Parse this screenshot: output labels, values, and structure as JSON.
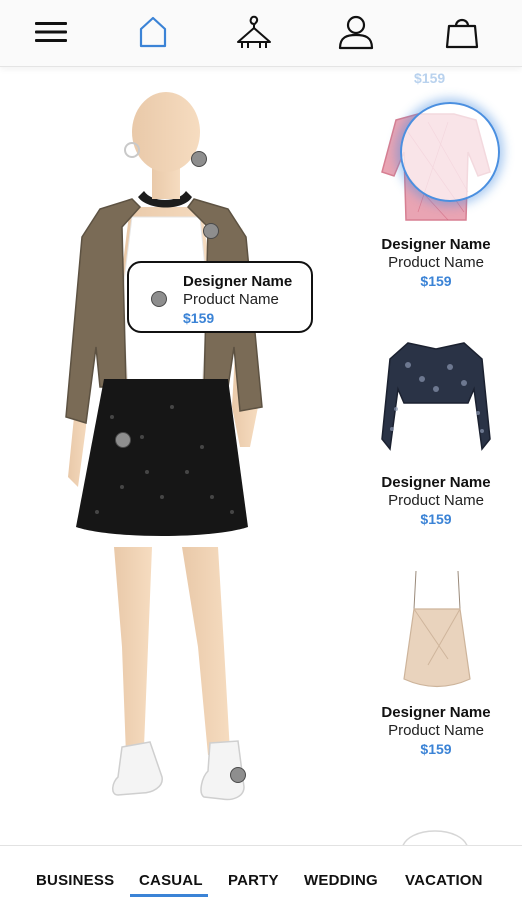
{
  "accent_color": "#3b83d6",
  "nav": {
    "items": [
      {
        "icon": "menu-icon"
      },
      {
        "icon": "home-icon",
        "active": true
      },
      {
        "icon": "hanger-icon"
      },
      {
        "icon": "user-icon"
      },
      {
        "icon": "bag-icon"
      }
    ]
  },
  "outfit": {
    "tooltip": {
      "designer": "Designer Name",
      "product": "Product Name",
      "price": "$159"
    }
  },
  "products": {
    "top_partial_price": "$159",
    "items": [
      {
        "designer": "Designer Name",
        "product": "Product Name",
        "price": "$159",
        "image": "pink-lace-top",
        "selected": true
      },
      {
        "designer": "Designer Name",
        "product": "Product Name",
        "price": "$159",
        "image": "black-lace-bolero",
        "selected": false
      },
      {
        "designer": "Designer Name",
        "product": "Product Name",
        "price": "$159",
        "image": "beige-cami",
        "selected": false
      }
    ]
  },
  "categories": {
    "tabs": [
      {
        "label": "BUSINESS"
      },
      {
        "label": "CASUAL",
        "active": true
      },
      {
        "label": "PARTY"
      },
      {
        "label": "WEDDING"
      },
      {
        "label": "VACATION"
      }
    ]
  }
}
